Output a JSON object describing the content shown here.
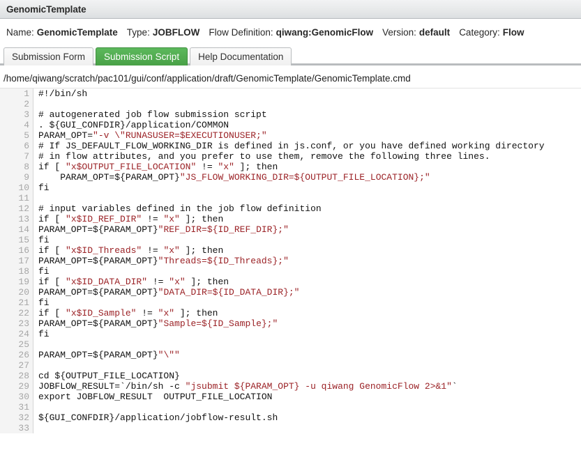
{
  "window": {
    "title": "GenomicTemplate"
  },
  "meta": {
    "items": [
      {
        "label": "Name:",
        "value": "GenomicTemplate"
      },
      {
        "label": "Type:",
        "value": "JOBFLOW"
      },
      {
        "label": "Flow Definition:",
        "value": "qiwang:GenomicFlow"
      },
      {
        "label": "Version:",
        "value": "default"
      },
      {
        "label": "Category:",
        "value": "Flow"
      }
    ]
  },
  "tabs": [
    {
      "label": "Submission Form",
      "active": false
    },
    {
      "label": "Submission Script",
      "active": true
    },
    {
      "label": "Help Documentation",
      "active": false
    }
  ],
  "file": {
    "path": "/home/qiwang/scratch/pac101/gui/conf/application/draft/GenomicTemplate/GenomicTemplate.cmd"
  },
  "editor": {
    "first_line": 1,
    "line_count": 33,
    "string_color": "#9b2226",
    "gutter_color": "#a6a6a6",
    "lines": [
      {
        "n": 1,
        "segments": [
          {
            "t": "#!/bin/sh"
          }
        ]
      },
      {
        "n": 2,
        "segments": [
          {
            "t": ""
          }
        ]
      },
      {
        "n": 3,
        "segments": [
          {
            "t": "# autogenerated job flow submission script"
          }
        ]
      },
      {
        "n": 4,
        "segments": [
          {
            "t": ". ${GUI_CONFDIR}/application/COMMON"
          }
        ]
      },
      {
        "n": 5,
        "segments": [
          {
            "t": "PARAM_OPT="
          },
          {
            "t": "\"-v \\\"RUNASUSER=$EXECUTIONUSER;\"",
            "s": true
          }
        ]
      },
      {
        "n": 6,
        "segments": [
          {
            "t": "# If JS_DEFAULT_FLOW_WORKING_DIR is defined in js.conf, or you have defined working directory"
          }
        ]
      },
      {
        "n": 7,
        "segments": [
          {
            "t": "# in flow attributes, and you prefer to use them, remove the following three lines."
          }
        ]
      },
      {
        "n": 8,
        "segments": [
          {
            "t": "if [ "
          },
          {
            "t": "\"x$OUTPUT_FILE_LOCATION\"",
            "s": true
          },
          {
            "t": " != "
          },
          {
            "t": "\"x\"",
            "s": true
          },
          {
            "t": " ]; then"
          }
        ]
      },
      {
        "n": 9,
        "segments": [
          {
            "t": "    PARAM_OPT=${PARAM_OPT}"
          },
          {
            "t": "\"JS_FLOW_WORKING_DIR=${OUTPUT_FILE_LOCATION};\"",
            "s": true
          }
        ]
      },
      {
        "n": 10,
        "segments": [
          {
            "t": "fi"
          }
        ]
      },
      {
        "n": 11,
        "segments": [
          {
            "t": ""
          }
        ]
      },
      {
        "n": 12,
        "segments": [
          {
            "t": "# input variables defined in the job flow definition"
          }
        ]
      },
      {
        "n": 13,
        "segments": [
          {
            "t": "if [ "
          },
          {
            "t": "\"x$ID_REF_DIR\"",
            "s": true
          },
          {
            "t": " != "
          },
          {
            "t": "\"x\"",
            "s": true
          },
          {
            "t": " ]; then"
          }
        ]
      },
      {
        "n": 14,
        "segments": [
          {
            "t": "PARAM_OPT=${PARAM_OPT}"
          },
          {
            "t": "\"REF_DIR=${ID_REF_DIR};\"",
            "s": true
          }
        ]
      },
      {
        "n": 15,
        "segments": [
          {
            "t": "fi"
          }
        ]
      },
      {
        "n": 16,
        "segments": [
          {
            "t": "if [ "
          },
          {
            "t": "\"x$ID_Threads\"",
            "s": true
          },
          {
            "t": " != "
          },
          {
            "t": "\"x\"",
            "s": true
          },
          {
            "t": " ]; then"
          }
        ]
      },
      {
        "n": 17,
        "segments": [
          {
            "t": "PARAM_OPT=${PARAM_OPT}"
          },
          {
            "t": "\"Threads=${ID_Threads};\"",
            "s": true
          }
        ]
      },
      {
        "n": 18,
        "segments": [
          {
            "t": "fi"
          }
        ]
      },
      {
        "n": 19,
        "segments": [
          {
            "t": "if [ "
          },
          {
            "t": "\"x$ID_DATA_DIR\"",
            "s": true
          },
          {
            "t": " != "
          },
          {
            "t": "\"x\"",
            "s": true
          },
          {
            "t": " ]; then"
          }
        ]
      },
      {
        "n": 20,
        "segments": [
          {
            "t": "PARAM_OPT=${PARAM_OPT}"
          },
          {
            "t": "\"DATA_DIR=${ID_DATA_DIR};\"",
            "s": true
          }
        ]
      },
      {
        "n": 21,
        "segments": [
          {
            "t": "fi"
          }
        ]
      },
      {
        "n": 22,
        "segments": [
          {
            "t": "if [ "
          },
          {
            "t": "\"x$ID_Sample\"",
            "s": true
          },
          {
            "t": " != "
          },
          {
            "t": "\"x\"",
            "s": true
          },
          {
            "t": " ]; then"
          }
        ]
      },
      {
        "n": 23,
        "segments": [
          {
            "t": "PARAM_OPT=${PARAM_OPT}"
          },
          {
            "t": "\"Sample=${ID_Sample};\"",
            "s": true
          }
        ]
      },
      {
        "n": 24,
        "segments": [
          {
            "t": "fi"
          }
        ]
      },
      {
        "n": 25,
        "segments": [
          {
            "t": ""
          }
        ]
      },
      {
        "n": 26,
        "segments": [
          {
            "t": "PARAM_OPT=${PARAM_OPT}"
          },
          {
            "t": "\"\\\"\"",
            "s": true
          }
        ]
      },
      {
        "n": 27,
        "segments": [
          {
            "t": ""
          }
        ]
      },
      {
        "n": 28,
        "segments": [
          {
            "t": "cd ${OUTPUT_FILE_LOCATION}"
          }
        ]
      },
      {
        "n": 29,
        "segments": [
          {
            "t": "JOBFLOW_RESULT=`/bin/sh -c "
          },
          {
            "t": "\"jsubmit ${PARAM_OPT} -u qiwang GenomicFlow 2>&1\"",
            "s": true
          },
          {
            "t": "`"
          }
        ]
      },
      {
        "n": 30,
        "segments": [
          {
            "t": "export JOBFLOW_RESULT  OUTPUT_FILE_LOCATION"
          }
        ]
      },
      {
        "n": 31,
        "segments": [
          {
            "t": ""
          }
        ]
      },
      {
        "n": 32,
        "segments": [
          {
            "t": "${GUI_CONFDIR}/application/jobflow-result.sh"
          }
        ]
      },
      {
        "n": 33,
        "segments": [
          {
            "t": ""
          }
        ]
      }
    ]
  }
}
